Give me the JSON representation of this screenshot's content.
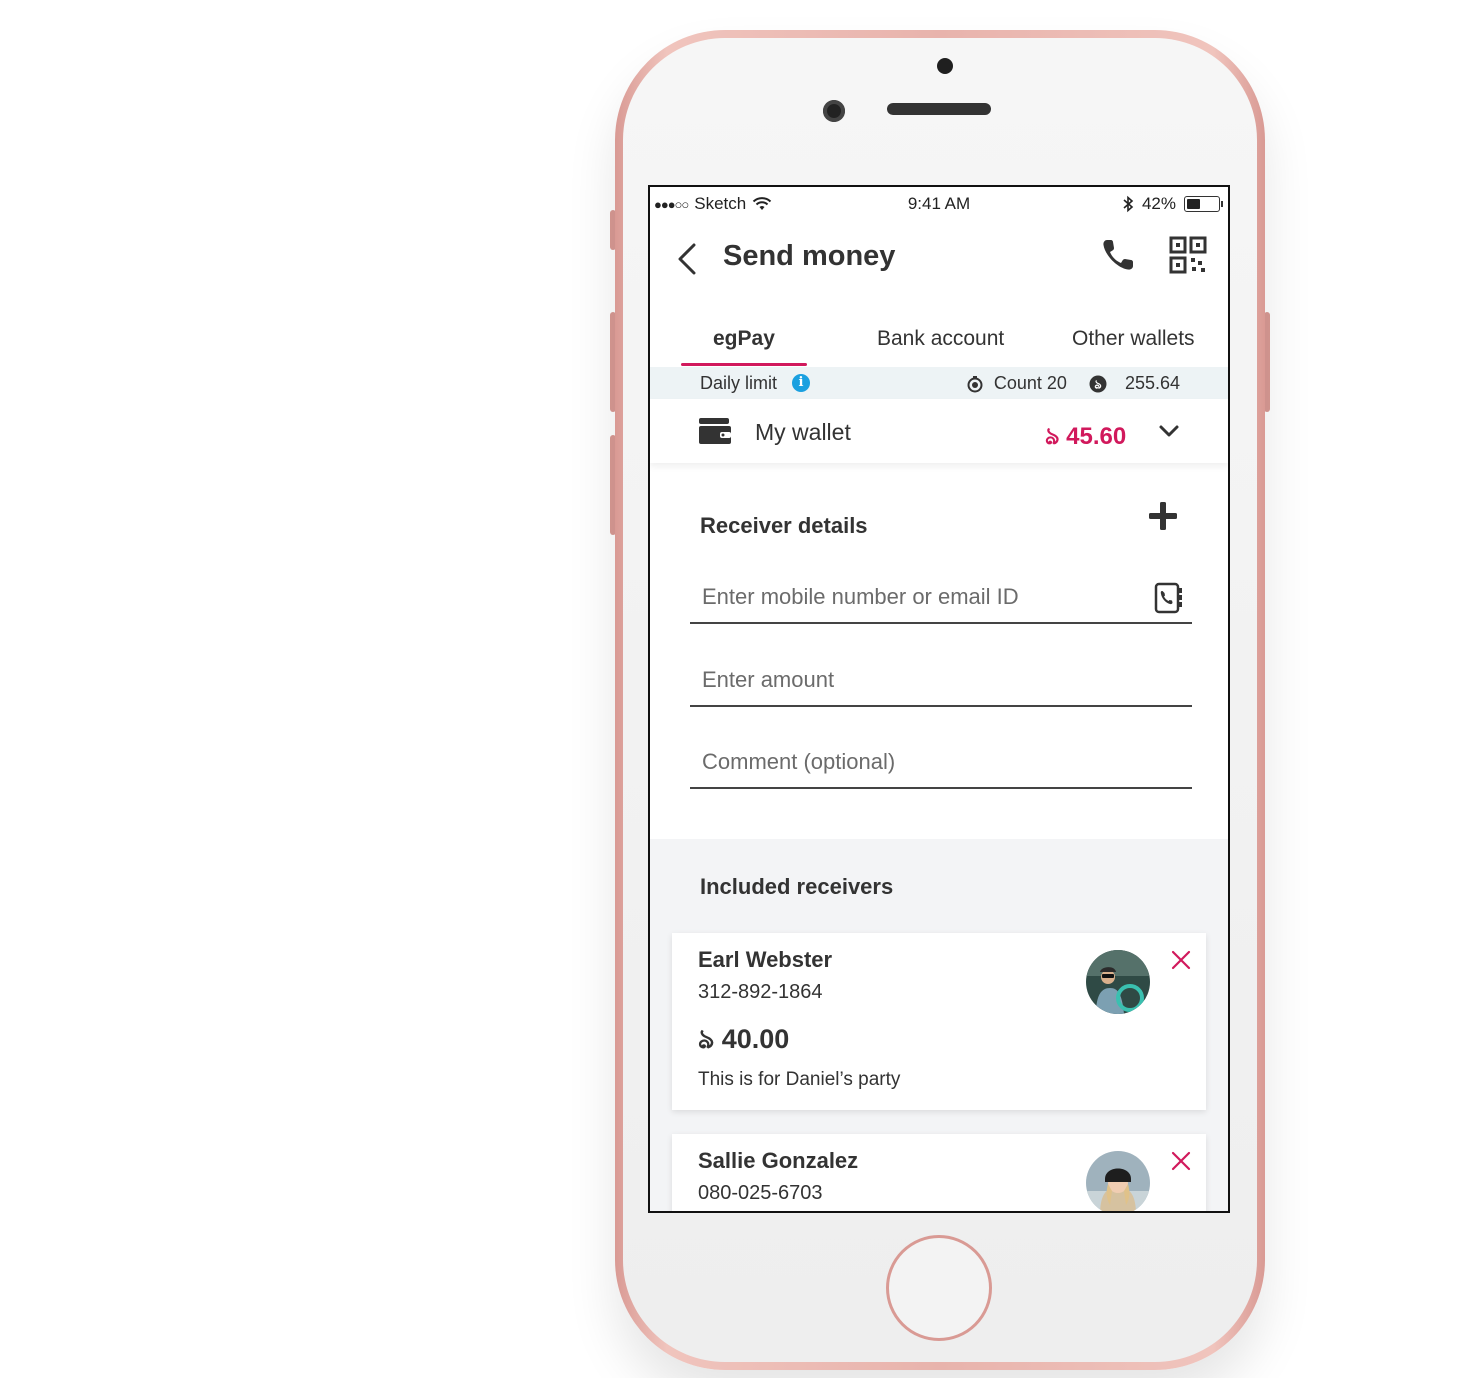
{
  "status_bar": {
    "carrier": "Sketch",
    "time": "9:41 AM",
    "battery": "42%",
    "battery_level": 0.42,
    "signal_icon": "signal-dots-icon",
    "wifi_icon": "wifi-icon",
    "bluetooth_icon": "bluetooth-icon"
  },
  "header": {
    "title": "Send money",
    "back_icon": "back-chevron-icon",
    "call_icon": "phone-icon",
    "qr_icon": "qr-code-icon"
  },
  "tabs": [
    {
      "label": "egPay",
      "active": true
    },
    {
      "label": "Bank account",
      "active": false
    },
    {
      "label": "Other wallets",
      "active": false
    }
  ],
  "daily_limit": {
    "label": "Daily limit",
    "info_icon": "info-icon",
    "count": "Count 20",
    "amount": "255.64"
  },
  "wallet": {
    "label": "My wallet",
    "amount": "ঌ 45.60",
    "icon": "wallet-icon"
  },
  "receiver_details": {
    "title": "Receiver details",
    "mobile_placeholder": "Enter mobile number or email ID",
    "amount_placeholder": "Enter amount",
    "comment_placeholder": "Comment (optional)"
  },
  "included_receivers": {
    "title": "Included receivers",
    "items": [
      {
        "name": "Earl Webster",
        "phone": "312-892-1864",
        "amount": "ঌ 40.00",
        "comment": "This is for Daniel’s party"
      },
      {
        "name": "Sallie Gonzalez",
        "phone": "080-025-6703"
      }
    ]
  },
  "colors": {
    "accent": "#d1195c",
    "info": "#1aa0e0",
    "limit_bg": "#edf3f5",
    "phone_frame": "#e8b3ac"
  }
}
